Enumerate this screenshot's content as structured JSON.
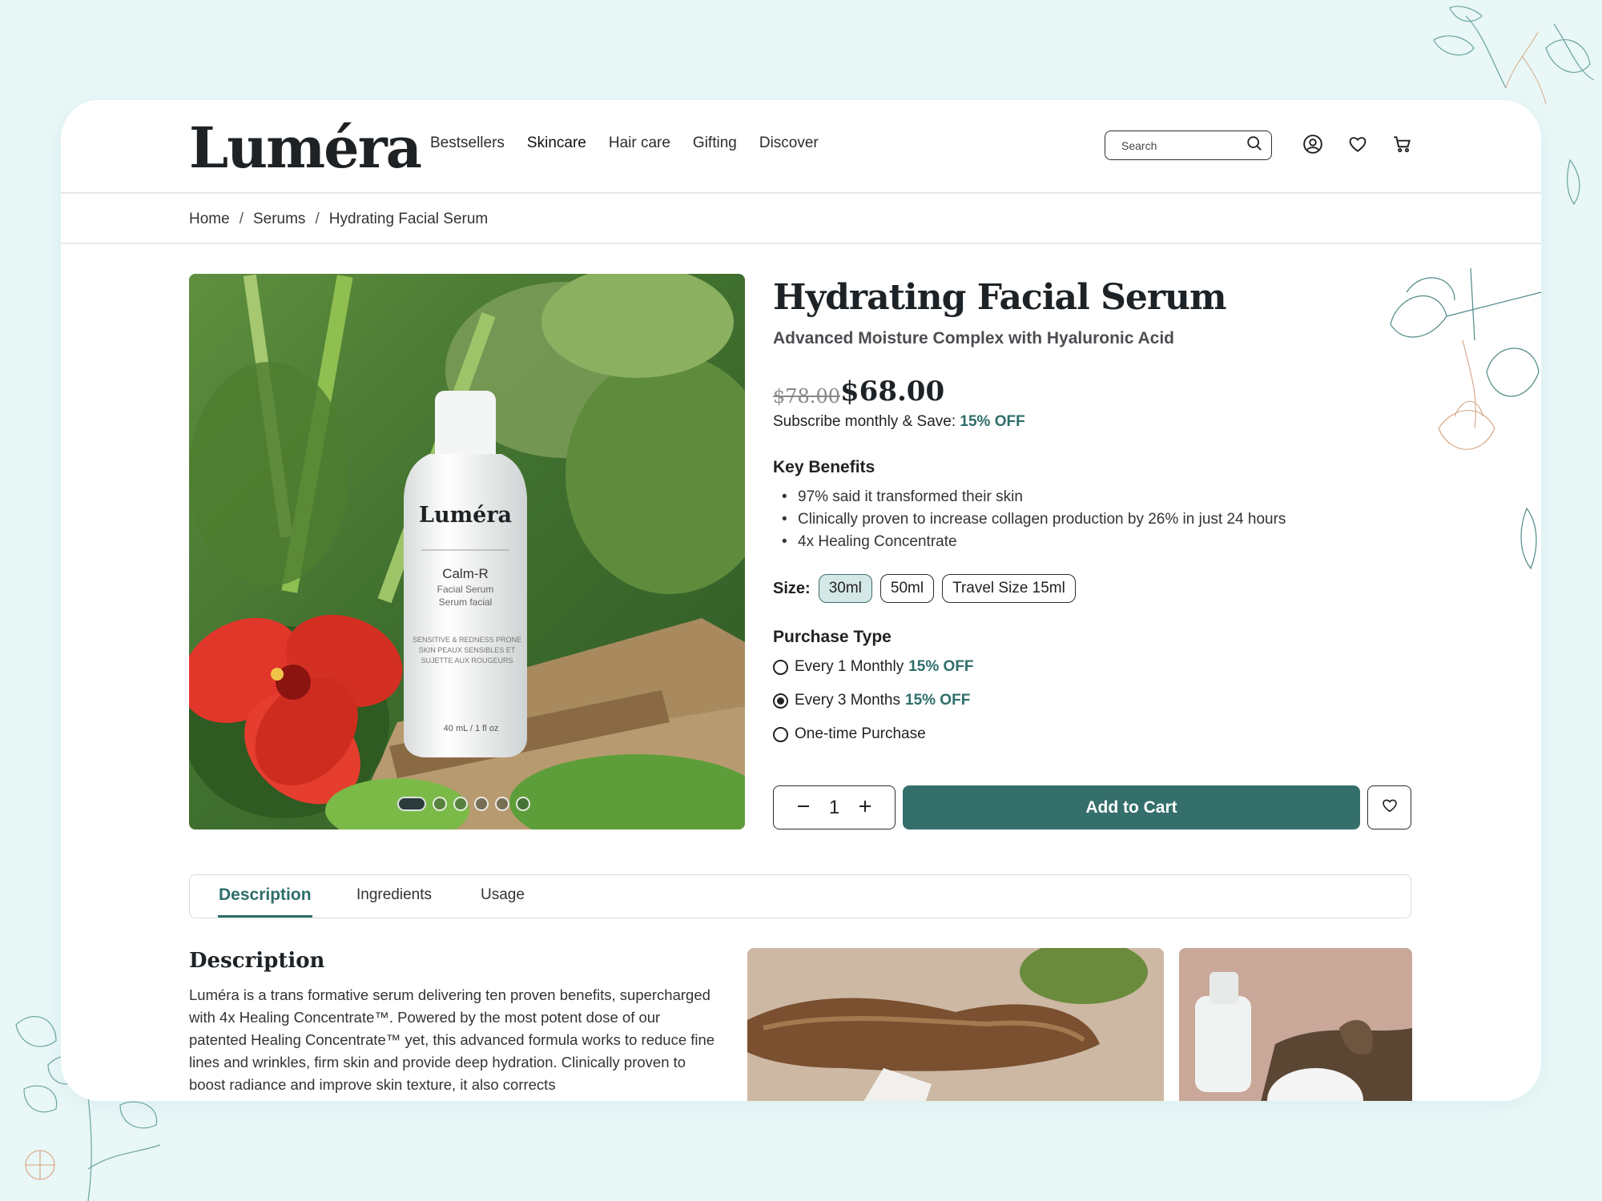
{
  "brand": {
    "logo": "Luméra"
  },
  "nav": {
    "items": [
      "Bestsellers",
      "Skincare",
      "Hair care",
      "Gifting",
      "Discover"
    ]
  },
  "search": {
    "placeholder": "Search"
  },
  "breadcrumb": [
    "Home",
    "Serums",
    "Hydrating Facial Serum"
  ],
  "product": {
    "title": "Hydrating Facial Serum",
    "subtitle": "Advanced Moisture Complex with Hyaluronic Acid",
    "old_price": "$78.00",
    "price": "$68.00",
    "subscribe_text": "Subscribe monthly & Save:",
    "subscribe_discount": "15% OFF",
    "image": {
      "bottle_brand": "Luméra",
      "bottle_name": "Calm-R",
      "bottle_line1": "Facial Serum",
      "bottle_line2": "Serum facial",
      "bottle_small1": "SENSITIVE & REDNESS PRONE",
      "bottle_small2": "SKIN PEAUX SENSIBLES ET",
      "bottle_small3": "SUJETTE AUX ROUGEURS",
      "bottle_volume": "40 mL / 1 fl oz"
    },
    "carousel": {
      "count": 6,
      "active": 0
    },
    "key_benefits_title": "Key Benefits",
    "benefits": [
      "97% said it transformed their skin",
      "Clinically proven to increase collagen production by 26% in just 24 hours",
      "4x Healing Concentrate"
    ],
    "size_label": "Size:",
    "sizes": [
      "30ml",
      "50ml",
      "Travel Size 15ml"
    ],
    "selected_size": "30ml",
    "purchase_type_title": "Purchase Type",
    "purchase_options": [
      {
        "label": "Every 1 Monthly",
        "discount": "15% OFF",
        "checked": false
      },
      {
        "label": "Every 3 Months",
        "discount": "15% OFF",
        "checked": true
      },
      {
        "label": "One-time Purchase",
        "discount": "",
        "checked": false
      }
    ],
    "quantity": "1",
    "add_to_cart": "Add to Cart"
  },
  "tabs": [
    "Description",
    "Ingredients",
    "Usage"
  ],
  "description": {
    "title": "Description",
    "text": "Luméra is a trans formative serum delivering ten proven benefits, supercharged with 4x Healing Concentrate™. Powered by the most potent dose of our patented Healing Concentrate™ yet, this advanced formula works to reduce fine lines and wrinkles, firm skin and provide deep hydration. Clinically proven to boost radiance and improve skin texture, it also corrects"
  },
  "colors": {
    "accent": "#356f6c",
    "background": "#e9f7f7",
    "size_selected": "#d4e8e7"
  },
  "icons": [
    "search-icon",
    "account-icon",
    "heart-icon",
    "cart-icon",
    "minus-icon",
    "plus-icon"
  ]
}
